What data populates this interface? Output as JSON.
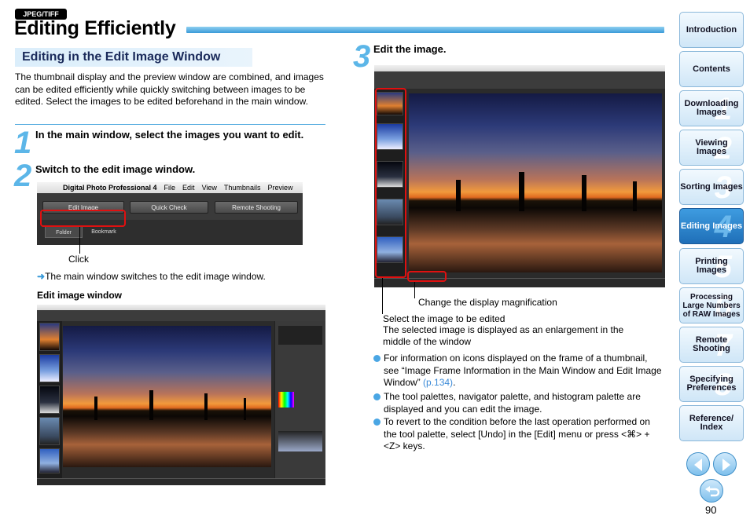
{
  "badge": "JPEG/TIFF",
  "title": "Editing Efficiently",
  "section_heading": "Editing in the Edit Image Window",
  "intro": "The thumbnail display and the preview window are combined, and images can be edited efficiently while quickly switching between images to be edited. Select the images to be edited beforehand in the main window.",
  "steps": [
    {
      "num": "1",
      "text": "In the main window, select the images you want to edit."
    },
    {
      "num": "2",
      "text": "Switch to the edit image window."
    },
    {
      "num": "3",
      "text": "Edit the image."
    }
  ],
  "shot1": {
    "apple": "",
    "menu": [
      "Digital Photo Professional 4",
      "File",
      "Edit",
      "View",
      "Thumbnails",
      "Preview"
    ],
    "buttons": [
      "Edit Image",
      "Quick Check",
      "Remote Shooting"
    ],
    "tabs": [
      "Folder",
      "Bookmark"
    ]
  },
  "click_label": "Click",
  "switch_note": "The main window switches to the edit image window.",
  "edit_window_label": "Edit image window",
  "callouts": {
    "magnification": "Change the display magnification",
    "select_line1": "Select the image to be edited",
    "select_line2": "The selected image is displayed as an enlargement in the middle of the window"
  },
  "bullets": {
    "b1_text": "For information on icons displayed on the frame of a thumbnail, see “Image Frame Information in the Main Window and Edit Image Window”",
    "b1_link": "(p.134)",
    "b1_end": ".",
    "b2": "The tool palettes, navigator palette, and histogram palette are displayed and you can edit the image.",
    "b3": "To revert to the condition before the last operation performed on the tool palette, select [Undo] in the [Edit] menu or press <⌘> + <Z> keys."
  },
  "nav": [
    {
      "label": "Introduction",
      "num": ""
    },
    {
      "label": "Contents",
      "num": ""
    },
    {
      "label": "Downloading Images",
      "num": "1"
    },
    {
      "label": "Viewing Images",
      "num": "2"
    },
    {
      "label": "Sorting Images",
      "num": "3"
    },
    {
      "label": "Editing Images",
      "num": "4"
    },
    {
      "label": "Printing Images",
      "num": "5"
    },
    {
      "label": "Processing Large Numbers of RAW Images",
      "num": "6"
    },
    {
      "label": "Remote Shooting",
      "num": "7"
    },
    {
      "label": "Specifying Preferences",
      "num": "8"
    },
    {
      "label": "Reference/ Index",
      "num": ""
    }
  ],
  "page_number": "90",
  "colors": {
    "accent": "#3a9ad8",
    "callout_red": "#e01010",
    "active_nav": "#1f6fb8"
  }
}
